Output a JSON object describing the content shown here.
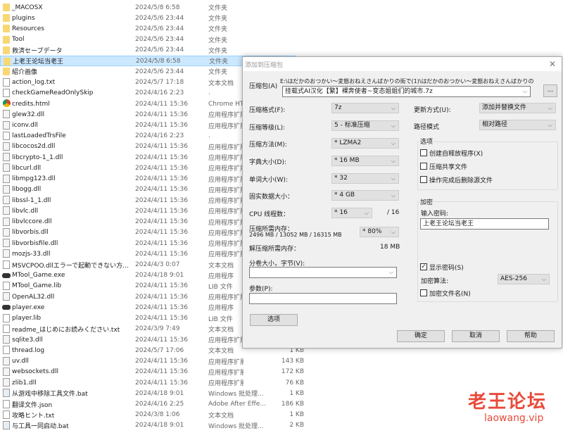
{
  "files": [
    {
      "name": "_MACOSX",
      "date": "2024/5/8 6:58",
      "type": "文件夹",
      "size": "",
      "icon": "folder"
    },
    {
      "name": "plugins",
      "date": "2024/5/6 23:44",
      "type": "文件夹",
      "size": "",
      "icon": "folder"
    },
    {
      "name": "Resources",
      "date": "2024/5/6 23:44",
      "type": "文件夹",
      "size": "",
      "icon": "folder"
    },
    {
      "name": "Tool",
      "date": "2024/5/6 23:44",
      "type": "文件夹",
      "size": "",
      "icon": "folder"
    },
    {
      "name": "救済セーブデータ",
      "date": "2024/5/6 23:44",
      "type": "文件夹",
      "size": "",
      "icon": "folder"
    },
    {
      "name": "上老王论坛当老王",
      "date": "2024/5/8 6:58",
      "type": "文件夹",
      "size": "",
      "icon": "folder",
      "selected": true
    },
    {
      "name": "紹介画像",
      "date": "2024/5/6 23:44",
      "type": "文件夹",
      "size": "",
      "icon": "folder"
    },
    {
      "name": "action_log.txt",
      "date": "2024/5/7 17:18",
      "type": "文本文档",
      "size": "",
      "icon": "file"
    },
    {
      "name": "checkGameReadOnlySkip",
      "date": "2024/4/16 2:23",
      "type": ".",
      "size": "",
      "icon": "file"
    },
    {
      "name": "credits.html",
      "date": "2024/4/11 15:36",
      "type": "Chrome HT",
      "size": "",
      "icon": "chrome"
    },
    {
      "name": "glew32.dll",
      "date": "2024/4/11 15:36",
      "type": "应用程序扩展",
      "size": "",
      "icon": "dll"
    },
    {
      "name": "iconv.dll",
      "date": "2024/4/11 15:36",
      "type": "应用程序扩展",
      "size": "",
      "icon": "dll"
    },
    {
      "name": "lastLoadedTrsFile",
      "date": "2024/4/16 2:23",
      "type": ".",
      "size": "",
      "icon": "file"
    },
    {
      "name": "libcocos2d.dll",
      "date": "2024/4/11 15:36",
      "type": "应用程序扩展",
      "size": "",
      "icon": "dll"
    },
    {
      "name": "libcrypto-1_1.dll",
      "date": "2024/4/11 15:36",
      "type": "应用程序扩展",
      "size": "",
      "icon": "dll"
    },
    {
      "name": "libcurl.dll",
      "date": "2024/4/11 15:36",
      "type": "应用程序扩展",
      "size": "",
      "icon": "dll"
    },
    {
      "name": "libmpg123.dll",
      "date": "2024/4/11 15:36",
      "type": "应用程序扩展",
      "size": "",
      "icon": "dll"
    },
    {
      "name": "libogg.dll",
      "date": "2024/4/11 15:36",
      "type": "应用程序扩展",
      "size": "",
      "icon": "dll"
    },
    {
      "name": "libssl-1_1.dll",
      "date": "2024/4/11 15:36",
      "type": "应用程序扩展",
      "size": "",
      "icon": "dll"
    },
    {
      "name": "libvlc.dll",
      "date": "2024/4/11 15:36",
      "type": "应用程序扩展",
      "size": "",
      "icon": "dll"
    },
    {
      "name": "libvlccore.dll",
      "date": "2024/4/11 15:36",
      "type": "应用程序扩展",
      "size": "",
      "icon": "dll"
    },
    {
      "name": "libvorbis.dll",
      "date": "2024/4/11 15:36",
      "type": "应用程序扩展",
      "size": "",
      "icon": "dll"
    },
    {
      "name": "libvorbisfile.dll",
      "date": "2024/4/11 15:36",
      "type": "应用程序扩展",
      "size": "",
      "icon": "dll"
    },
    {
      "name": "mozjs-33.dll",
      "date": "2024/4/11 15:36",
      "type": "应用程序扩展",
      "size": "",
      "icon": "dll"
    },
    {
      "name": "MSVCPOO.dllエラーで起動できない方...",
      "date": "2024/4/3 0:07",
      "type": "文本文档",
      "size": "",
      "icon": "file"
    },
    {
      "name": "MTool_Game.exe",
      "date": "2024/4/18 9:01",
      "type": "应用程序",
      "size": "",
      "icon": "exe"
    },
    {
      "name": "MTool_Game.lib",
      "date": "2024/4/11 15:36",
      "type": "LIB 文件",
      "size": "",
      "icon": "file"
    },
    {
      "name": "OpenAL32.dll",
      "date": "2024/4/11 15:36",
      "type": "应用程序扩展",
      "size": "",
      "icon": "dll"
    },
    {
      "name": "player.exe",
      "date": "2024/4/11 15:36",
      "type": "应用程序",
      "size": "",
      "icon": "exe"
    },
    {
      "name": "player.lib",
      "date": "2024/4/11 15:36",
      "type": "LIB 文件",
      "size": "",
      "icon": "file"
    },
    {
      "name": "readme_はじめにお読みください.txt",
      "date": "2024/3/9 7:49",
      "type": "文本文档",
      "size": "",
      "icon": "file"
    },
    {
      "name": "sqlite3.dll",
      "date": "2024/4/11 15:36",
      "type": "应用程序扩展",
      "size": "",
      "icon": "dll"
    },
    {
      "name": "thread.log",
      "date": "2024/5/7 17:06",
      "type": "文本文档",
      "size": "1 KB",
      "icon": "file"
    },
    {
      "name": "uv.dll",
      "date": "2024/4/11 15:36",
      "type": "应用程序扩展",
      "size": "143 KB",
      "icon": "dll"
    },
    {
      "name": "websockets.dll",
      "date": "2024/4/11 15:36",
      "type": "应用程序扩展",
      "size": "172 KB",
      "icon": "dll"
    },
    {
      "name": "zlib1.dll",
      "date": "2024/4/11 15:36",
      "type": "应用程序扩展",
      "size": "76 KB",
      "icon": "dll"
    },
    {
      "name": "从游戏中移除工具文件.bat",
      "date": "2024/4/18 9:01",
      "type": "Windows 批处理...",
      "size": "1 KB",
      "icon": "bat"
    },
    {
      "name": "翻译文件.json",
      "date": "2024/4/16 2:25",
      "type": "Adobe After Effe...",
      "size": "186 KB",
      "icon": "file"
    },
    {
      "name": "攻略ヒント.txt",
      "date": "2024/3/8 1:06",
      "type": "文本文档",
      "size": "1 KB",
      "icon": "file"
    },
    {
      "name": "与工具一同启动.bat",
      "date": "2024/4/18 9:01",
      "type": "Windows 批处理...",
      "size": "2 KB",
      "icon": "bat"
    }
  ],
  "dialog": {
    "title": "添加到压缩包",
    "archive_label": "压缩包(A)",
    "archive_path": "E:\\はだかのおつかい～変態おねえさんばかりの街で(1)\\はだかのおつかい～変態おねえさんばかりの",
    "archive_name": "挂载式AI汉化【繁】裸奔使者~变态姐姐们的城市.7z",
    "browse": "...",
    "format_label": "压缩格式(F):",
    "format": "7z",
    "level_label": "压缩等级(L):",
    "level": "5 - 标准压缩",
    "method_label": "压缩方法(M):",
    "method": "* LZMA2",
    "dict_label": "字典大小(D):",
    "dict": "* 16 MB",
    "word_label": "单词大小(W):",
    "word": "* 32",
    "solid_label": "固实数据大小：",
    "solid": "* 4 GB",
    "cpu_label": "CPU 线程数：",
    "cpu": "* 16",
    "cpu_max": "/ 16",
    "mem_label": "压缩所需内存：",
    "mem_value": "2496 MB / 13052 MB / 16315 MB",
    "mem_pct": "* 80%",
    "decomp_label": "解压缩所需内存：",
    "decomp_value": "18 MB",
    "split_label": "分卷大小，字节(V):",
    "split": "",
    "params_label": "参数(P):",
    "params": "",
    "options_btn": "选项",
    "update_label": "更新方式(U):",
    "update": "添加并替换文件",
    "path_label": "路径模式",
    "path": "相对路径",
    "opts_group": "选项",
    "opt_sfx": "创建自释放程序(X)",
    "opt_shared": "压缩共享文件",
    "opt_delete": "操作完成后删除源文件",
    "enc_group": "加密",
    "pwd_label": "输入密码:",
    "pwd": "上老王论坛当老王",
    "show_pwd": "显示密码(S)",
    "show_pwd_checked": true,
    "enc_method_label": "加密算法:",
    "enc_method": "AES-256",
    "enc_names": "加密文件名(N)",
    "ok": "确定",
    "cancel": "取消",
    "help": "帮助"
  },
  "watermark": {
    "text": "老王论坛",
    "url": "laowang.vip"
  }
}
